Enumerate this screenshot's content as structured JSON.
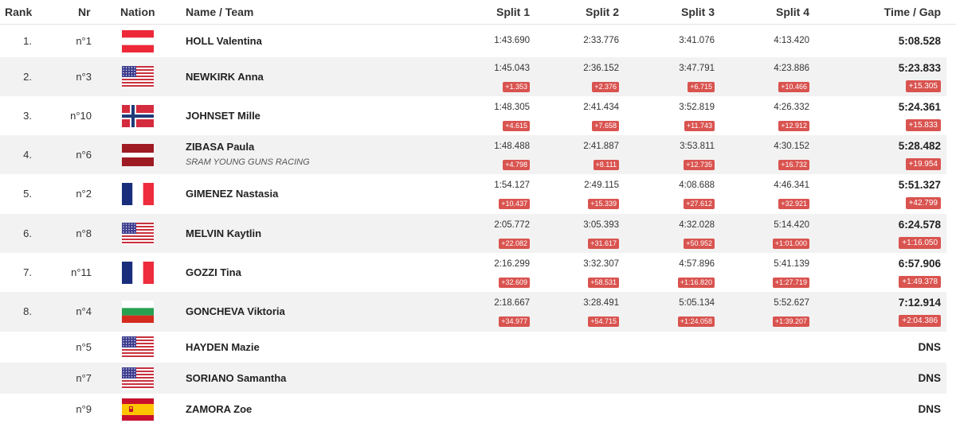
{
  "headers": {
    "rank": "Rank",
    "nr": "Nr",
    "nation": "Nation",
    "name": "Name / Team",
    "split1": "Split 1",
    "split2": "Split 2",
    "split3": "Split 3",
    "split4": "Split 4",
    "time": "Time / Gap"
  },
  "rows": [
    {
      "rank": "1.",
      "nr": "n°1",
      "nation": "austria-flag-icon",
      "name": "HOLL Valentina",
      "team": "",
      "splits": [
        "1:43.690",
        "2:33.776",
        "3:41.076",
        "4:13.420"
      ],
      "gaps": [
        "",
        "",
        "",
        ""
      ],
      "time": "5:08.528",
      "gap": ""
    },
    {
      "rank": "2.",
      "nr": "n°3",
      "nation": "usa-flag-icon",
      "name": "NEWKIRK Anna",
      "team": "",
      "splits": [
        "1:45.043",
        "2:36.152",
        "3:47.791",
        "4:23.886"
      ],
      "gaps": [
        "+1.353",
        "+2.376",
        "+6.715",
        "+10.466"
      ],
      "time": "5:23.833",
      "gap": "+15.305"
    },
    {
      "rank": "3.",
      "nr": "n°10",
      "nation": "norway-flag-icon",
      "name": "JOHNSET Mille",
      "team": "",
      "splits": [
        "1:48.305",
        "2:41.434",
        "3:52.819",
        "4:26.332"
      ],
      "gaps": [
        "+4.615",
        "+7.658",
        "+11.743",
        "+12.912"
      ],
      "time": "5:24.361",
      "gap": "+15.833"
    },
    {
      "rank": "4.",
      "nr": "n°6",
      "nation": "latvia-flag-icon",
      "name": "ZIBASA Paula",
      "team": "SRAM YOUNG GUNS RACING",
      "splits": [
        "1:48.488",
        "2:41.887",
        "3:53.811",
        "4:30.152"
      ],
      "gaps": [
        "+4.798",
        "+8.111",
        "+12.735",
        "+16.732"
      ],
      "time": "5:28.482",
      "gap": "+19.954"
    },
    {
      "rank": "5.",
      "nr": "n°2",
      "nation": "france-flag-icon",
      "name": "GIMENEZ Nastasia",
      "team": "",
      "splits": [
        "1:54.127",
        "2:49.115",
        "4:08.688",
        "4:46.341"
      ],
      "gaps": [
        "+10.437",
        "+15.339",
        "+27.612",
        "+32.921"
      ],
      "time": "5:51.327",
      "gap": "+42.799"
    },
    {
      "rank": "6.",
      "nr": "n°8",
      "nation": "usa-flag-icon",
      "name": "MELVIN Kaytlin",
      "team": "",
      "splits": [
        "2:05.772",
        "3:05.393",
        "4:32.028",
        "5:14.420"
      ],
      "gaps": [
        "+22.082",
        "+31.617",
        "+50.952",
        "+1:01.000"
      ],
      "time": "6:24.578",
      "gap": "+1:16.050"
    },
    {
      "rank": "7.",
      "nr": "n°11",
      "nation": "france-flag-icon",
      "name": "GOZZI Tina",
      "team": "",
      "splits": [
        "2:16.299",
        "3:32.307",
        "4:57.896",
        "5:41.139"
      ],
      "gaps": [
        "+32.609",
        "+58.531",
        "+1:16.820",
        "+1:27.719"
      ],
      "time": "6:57.906",
      "gap": "+1:49.378"
    },
    {
      "rank": "8.",
      "nr": "n°4",
      "nation": "bulgaria-flag-icon",
      "name": "GONCHEVA Viktoria",
      "team": "",
      "splits": [
        "2:18.667",
        "3:28.491",
        "5:05.134",
        "5:52.627"
      ],
      "gaps": [
        "+34.977",
        "+54.715",
        "+1:24.058",
        "+1:39.207"
      ],
      "time": "7:12.914",
      "gap": "+2:04.386"
    },
    {
      "rank": "",
      "nr": "n°5",
      "nation": "usa-flag-icon",
      "name": "HAYDEN Mazie",
      "team": "",
      "splits": [
        "",
        "",
        "",
        ""
      ],
      "gaps": [
        "",
        "",
        "",
        ""
      ],
      "time": "DNS",
      "gap": ""
    },
    {
      "rank": "",
      "nr": "n°7",
      "nation": "usa-flag-icon",
      "name": "SORIANO Samantha",
      "team": "",
      "splits": [
        "",
        "",
        "",
        ""
      ],
      "gaps": [
        "",
        "",
        "",
        ""
      ],
      "time": "DNS",
      "gap": ""
    },
    {
      "rank": "",
      "nr": "n°9",
      "nation": "spain-flag-icon",
      "name": "ZAMORA Zoe",
      "team": "",
      "splits": [
        "",
        "",
        "",
        ""
      ],
      "gaps": [
        "",
        "",
        "",
        ""
      ],
      "time": "DNS",
      "gap": ""
    }
  ]
}
